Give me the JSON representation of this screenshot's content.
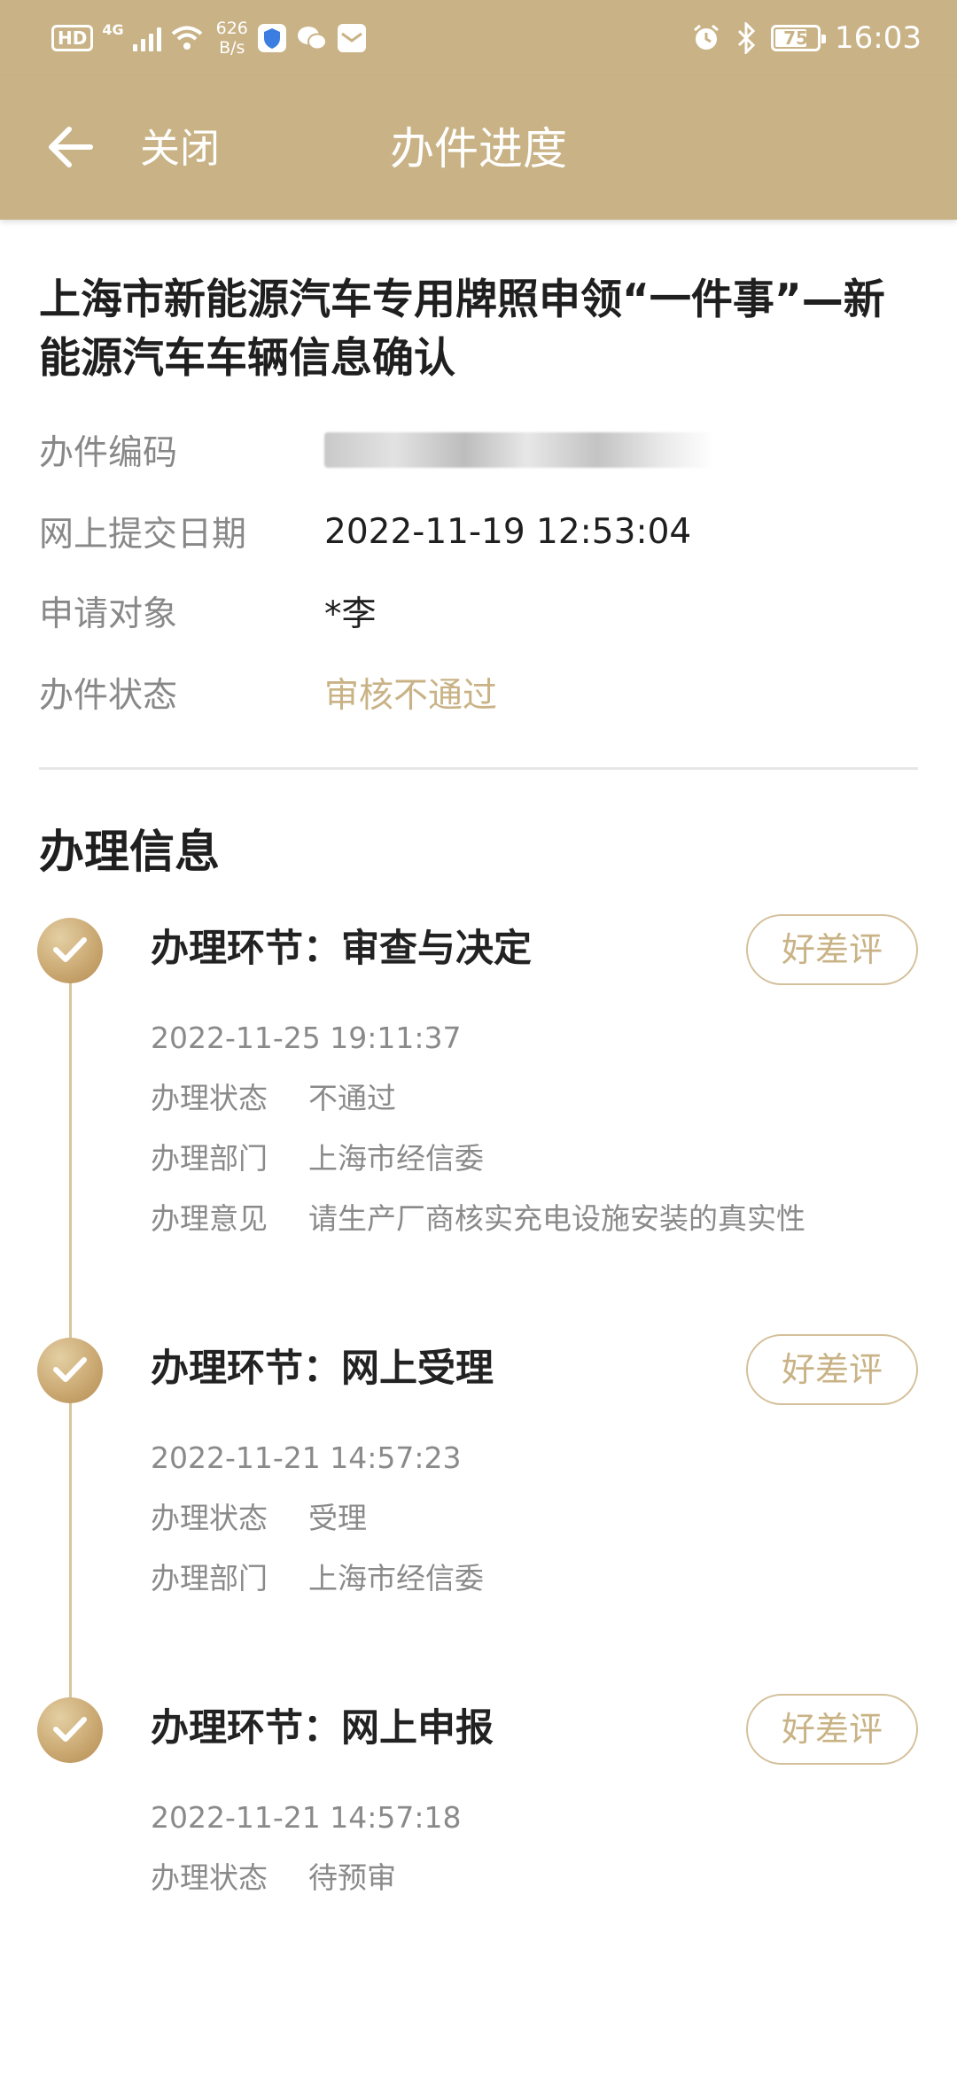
{
  "status_bar": {
    "hd": "HD",
    "network": "4G",
    "speed_value": "626",
    "speed_unit": "B/s",
    "battery": "75",
    "battery_level": 0.75,
    "time": "16:03"
  },
  "header": {
    "back_icon": "arrow-left-icon",
    "close_label": "关闭",
    "title": "办件进度",
    "bg_color": "#c9b386"
  },
  "application": {
    "title": "上海市新能源汽车专用牌照申领“一件事”—新能源汽车车辆信息确认",
    "fields": {
      "code_label": "办件编码",
      "submit_label": "网上提交日期",
      "submit_value": "2022-11-19 12:53:04",
      "applicant_label": "申请对象",
      "applicant_value": "*李",
      "status_label": "办件状态",
      "status_value": "审核不通过"
    }
  },
  "processing": {
    "section_title": "办理信息",
    "rate_label": "好差评",
    "steps": [
      {
        "title": "办理环节：审查与决定",
        "time": "2022-11-25 19:11:37",
        "details": [
          {
            "label": "办理状态",
            "value": "不通过"
          },
          {
            "label": "办理部门",
            "value": "上海市经信委"
          },
          {
            "label": "办理意见",
            "value": "请生产厂商核实充电设施安装的真实性"
          }
        ]
      },
      {
        "title": "办理环节：网上受理",
        "time": "2022-11-21 14:57:23",
        "details": [
          {
            "label": "办理状态",
            "value": "受理"
          },
          {
            "label": "办理部门",
            "value": "上海市经信委"
          }
        ]
      },
      {
        "title": "办理环节：网上申报",
        "time": "2022-11-21 14:57:18",
        "details": [
          {
            "label": "办理状态",
            "value": "待预审"
          }
        ]
      }
    ]
  },
  "colors": {
    "accent": "#c9b386",
    "check_badge": "#c9a66f",
    "muted_text": "#888888"
  }
}
